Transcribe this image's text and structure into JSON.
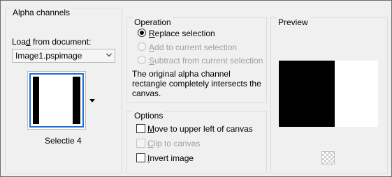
{
  "alpha_channels": {
    "title": "Alpha channels",
    "load_from_document_label": "Load from document:",
    "document_selected": "Image1.pspimage",
    "thumbnail_caption": "Selectie 4"
  },
  "operation": {
    "title": "Operation",
    "options": [
      {
        "label": "Replace selection",
        "selected": true,
        "enabled": true
      },
      {
        "label": "Add to current selection",
        "selected": false,
        "enabled": false
      },
      {
        "label": "Subtract from current selection",
        "selected": false,
        "enabled": false
      }
    ],
    "description": "The original alpha channel rectangle completely intersects the canvas."
  },
  "options": {
    "title": "Options",
    "checkboxes": [
      {
        "label": "Move to upper left of canvas",
        "checked": false,
        "enabled": true
      },
      {
        "label": "Clip to canvas",
        "checked": false,
        "enabled": false
      },
      {
        "label": "Invert image",
        "checked": false,
        "enabled": true
      }
    ]
  },
  "preview": {
    "title": "Preview"
  },
  "colors": {
    "selection_border": "#1e6fd6",
    "disabled_text": "#a0a0a0"
  }
}
